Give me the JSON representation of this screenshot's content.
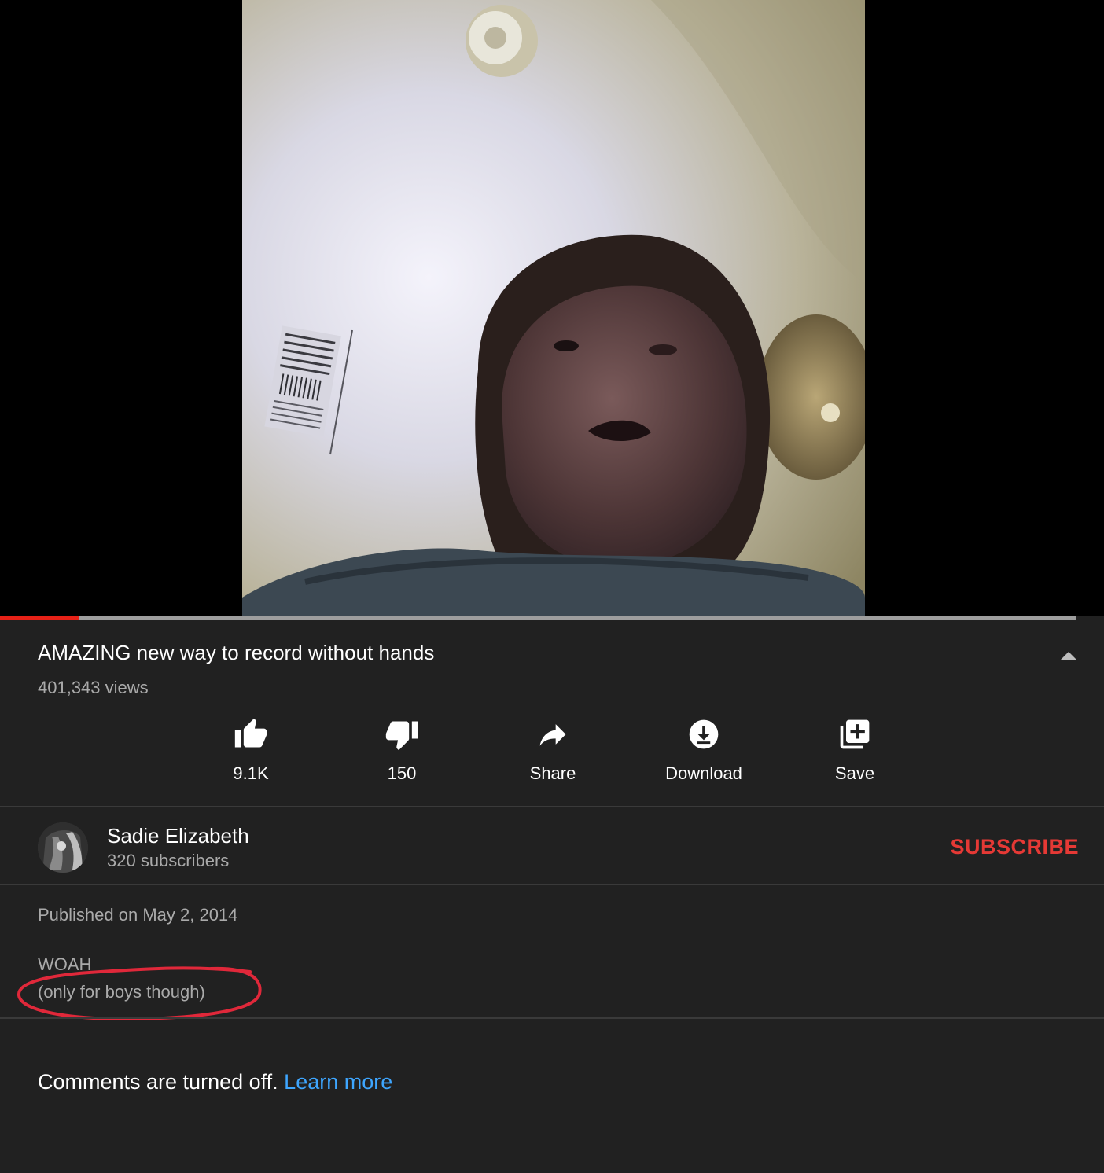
{
  "video": {
    "progress_fraction": 0.074
  },
  "info": {
    "title": "AMAZING new way to record without hands",
    "views": "401,343 views"
  },
  "actions": {
    "like": {
      "icon": "thumbs-up-icon",
      "label": "9.1K"
    },
    "dislike": {
      "icon": "thumbs-down-icon",
      "label": "150"
    },
    "share": {
      "icon": "share-icon",
      "label": "Share"
    },
    "download": {
      "icon": "download-icon",
      "label": "Download"
    },
    "save": {
      "icon": "playlist-add-icon",
      "label": "Save"
    }
  },
  "channel": {
    "name": "Sadie Elizabeth",
    "subscribers": "320 subscribers",
    "subscribe_label": "SUBSCRIBE"
  },
  "description": {
    "published": "Published on May 2, 2014",
    "lines": [
      "WOAH",
      "(only for boys though)"
    ]
  },
  "comments": {
    "status": "Comments are turned off.",
    "learn_more": "Learn more"
  },
  "colors": {
    "background": "#212121",
    "accent_red": "#e53935",
    "link_blue": "#3ea6ff",
    "annotation_red": "#e0283a"
  }
}
